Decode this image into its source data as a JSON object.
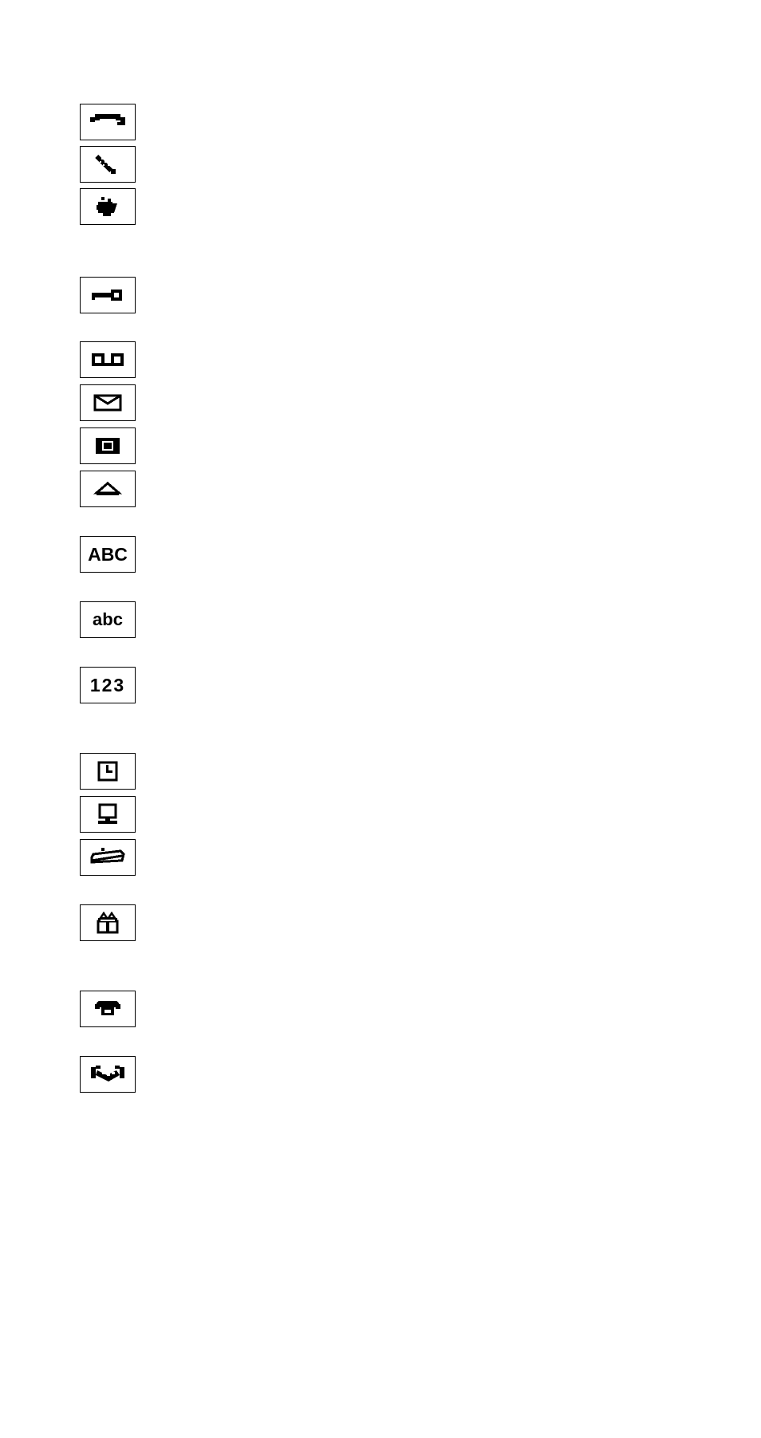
{
  "icons": {
    "uppercase_label": "ABC",
    "lowercase_label": "abc",
    "numeric_label": "123"
  }
}
